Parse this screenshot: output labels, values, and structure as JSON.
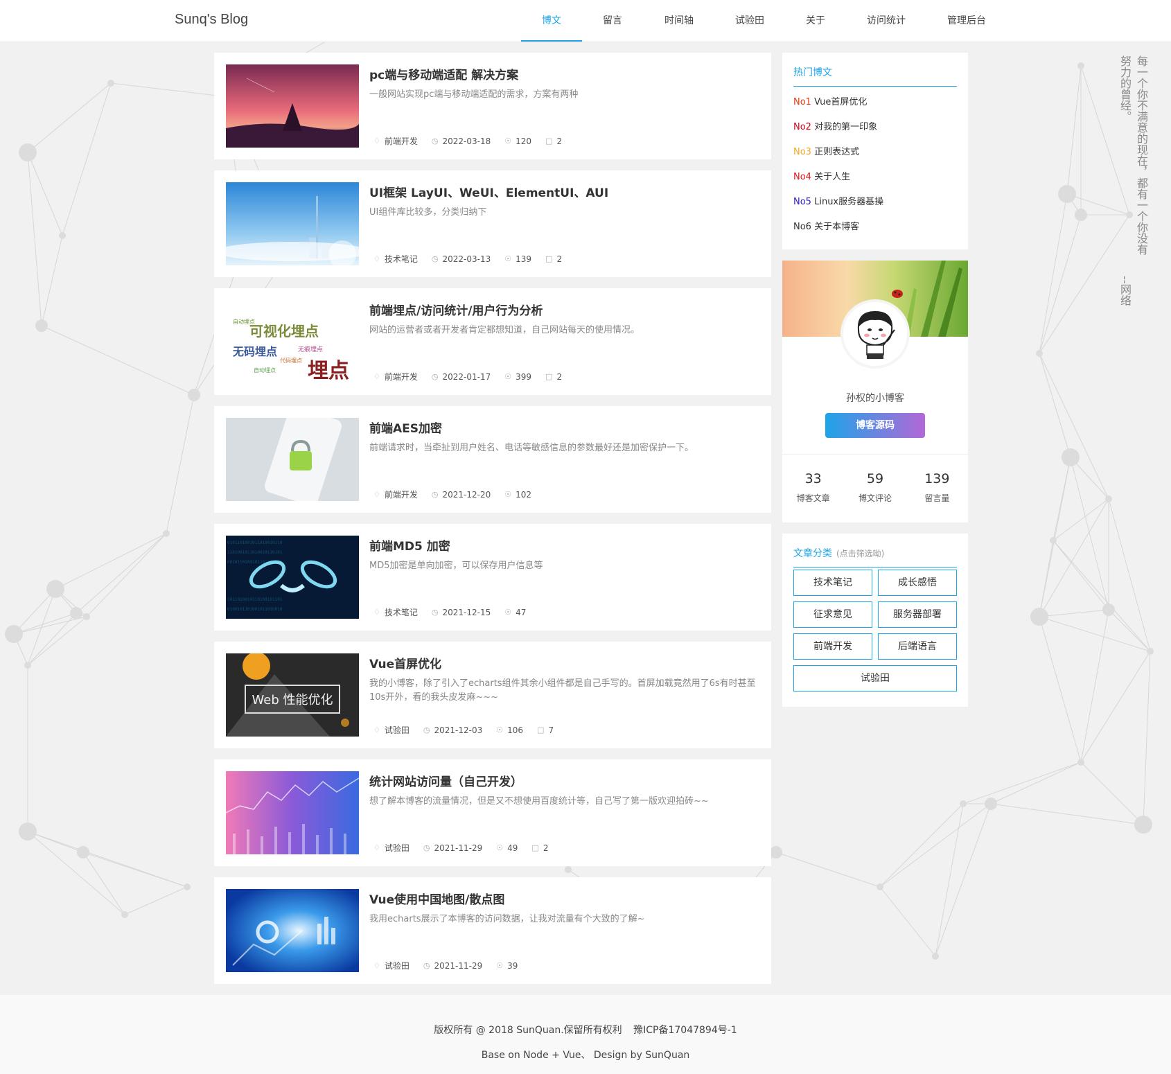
{
  "header": {
    "logo": "Sunq's Blog",
    "nav": [
      {
        "label": "博文",
        "active": true
      },
      {
        "label": "留言"
      },
      {
        "label": "时间轴"
      },
      {
        "label": "试验田"
      },
      {
        "label": "关于"
      },
      {
        "label": "访问统计"
      },
      {
        "label": "管理后台"
      }
    ]
  },
  "posts": [
    {
      "title": "pc端与移动端适配 解决方案",
      "desc": "一般网站实现pc端与移动端适配的需求，方案有两种",
      "category": "前端开发",
      "date": "2022-03-18",
      "views": "120",
      "comments": "2",
      "thumb_icon": "sunset-pyramid-image"
    },
    {
      "title": "UI框架 LayUI、WeUI、ElementUI、AUI",
      "desc": "UI组件库比较多，分类归纳下",
      "category": "技术笔记",
      "date": "2022-03-13",
      "views": "139",
      "comments": "2",
      "thumb_icon": "blue-sky-city-image"
    },
    {
      "title": "前端埋点/访问统计/用户行为分析",
      "desc": "网站的运营者或者开发者肯定都想知道，自己网站每天的使用情况。",
      "category": "前端开发",
      "date": "2022-01-17",
      "views": "399",
      "comments": "2",
      "thumb_icon": "word-cloud-image"
    },
    {
      "title": "前端AES加密",
      "desc": "前端请求时，当牵扯到用户姓名、电话等敏感信息的参数最好还是加密保护一下。",
      "category": "前端开发",
      "date": "2021-12-20",
      "views": "102",
      "comments": "",
      "thumb_icon": "phone-padlock-image"
    },
    {
      "title": "前端MD5 加密",
      "desc": "MD5加密是单向加密，可以保存用户信息等",
      "category": "技术笔记",
      "date": "2021-12-15",
      "views": "47",
      "comments": "",
      "thumb_icon": "digital-handshake-image"
    },
    {
      "title": "Vue首屏优化",
      "desc": "我的小博客，除了引入了echarts组件其余小组件都是自己手写的。首屏加载竟然用了6s有时甚至10s开外，看的我头皮发麻~~~",
      "category": "试验田",
      "date": "2021-12-03",
      "views": "106",
      "comments": "7",
      "thumb_icon": "web-performance-image"
    },
    {
      "title": "统计网站访问量（自己开发）",
      "desc": "想了解本博客的流量情况，但是又不想使用百度统计等，自己写了第一版欢迎拍砖~~",
      "category": "试验田",
      "date": "2021-11-29",
      "views": "49",
      "comments": "2",
      "thumb_icon": "stock-chart-image"
    },
    {
      "title": "Vue使用中国地图/散点图",
      "desc": "我用echarts展示了本博客的访问数据，让我对流量有个大致的了解~",
      "category": "试验田",
      "date": "2021-11-29",
      "views": "39",
      "comments": "",
      "thumb_icon": "data-globe-image"
    }
  ],
  "thumb_texts": {
    "wordcloud_big": "可视化埋点",
    "wordcloud_mid": "无码埋点",
    "wordcloud_main": "埋点",
    "wordcloud_small1": "自动埋点",
    "wordcloud_small2": "无痕埋点",
    "wordcloud_small3": "代码埋点",
    "web_perf": "Web 性能优化"
  },
  "sidebar": {
    "hot": {
      "title": "热门博文",
      "items": [
        {
          "rank": "No1",
          "text": "Vue首屏优化",
          "color": "#e8380d"
        },
        {
          "rank": "No2",
          "text": "对我的第一印象",
          "color": "#d0021b"
        },
        {
          "rank": "No3",
          "text": "正则表达式",
          "color": "#f5a623"
        },
        {
          "rank": "No4",
          "text": "关于人生",
          "color": "#e8101b"
        },
        {
          "rank": "No5",
          "text": "Linux服务器基操",
          "color": "#2c20c8"
        },
        {
          "rank": "No6",
          "text": "关于本博客",
          "color": "#333333"
        }
      ]
    },
    "profile": {
      "name": "孙权的小博客",
      "button": "博客源码",
      "stats": [
        {
          "num": "33",
          "label": "博客文章"
        },
        {
          "num": "59",
          "label": "博文评论"
        },
        {
          "num": "139",
          "label": "留言量"
        }
      ]
    },
    "categories": {
      "title": "文章分类",
      "hint": "(点击筛选呦)",
      "items": [
        "技术笔记",
        "成长感悟",
        "征求意见",
        "服务器部署",
        "前端开发",
        "后端语言",
        "试验田"
      ]
    }
  },
  "quote": {
    "col1": "每一个你不满意的现在，都有一个你没有",
    "col2": "努力的曾经。",
    "author": "--网络"
  },
  "footer": {
    "copyright": "版权所有 @ 2018 SunQuan.保留所有权利",
    "icp": "豫ICP备17047894号-1",
    "tech": "Base on Node + Vue、 Design by SunQuan"
  },
  "colors": {
    "accent": "#1ea4e8",
    "gradient_end": "#b268d6"
  }
}
